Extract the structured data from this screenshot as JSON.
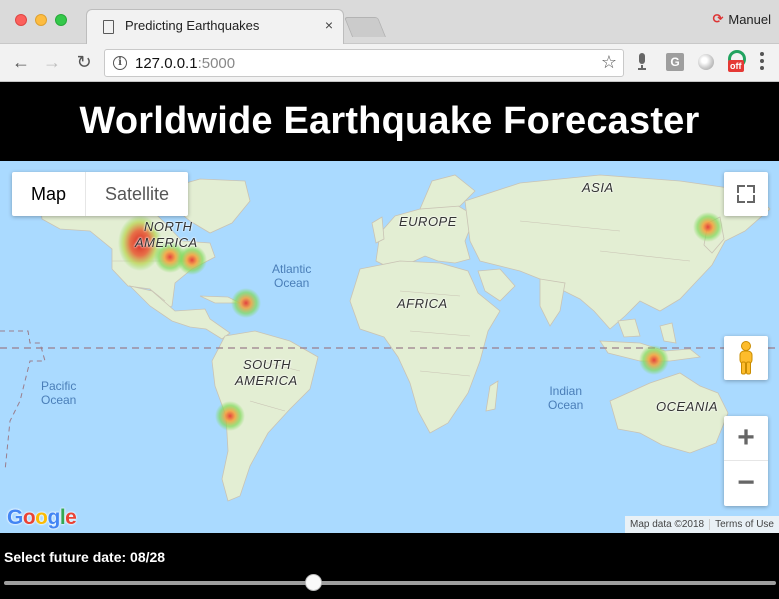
{
  "browser": {
    "tab_title": "Predicting Earthquakes",
    "tab_close": "×",
    "url_host": "127.0.0.1",
    "url_port": ":5000",
    "profile_name": "Manuel",
    "ext_g_label": "G",
    "ext_off_label": "off"
  },
  "page": {
    "title": "Worldwide Earthquake Forecaster"
  },
  "map": {
    "type_buttons": {
      "map": "Map",
      "satellite": "Satellite"
    },
    "labels": {
      "north_america_1": "NORTH",
      "north_america_2": "AMERICA",
      "south_america_1": "SOUTH",
      "south_america_2": "AMERICA",
      "europe": "EUROPE",
      "asia": "ASIA",
      "africa": "AFRICA",
      "oceania": "OCEANIA"
    },
    "oceans": {
      "atlantic_1": "Atlantic",
      "atlantic_2": "Ocean",
      "pacific_1": "Pacific",
      "pacific_2": "Ocean",
      "indian_1": "Indian",
      "indian_2": "Ocean"
    },
    "zoom_in": "+",
    "zoom_out": "−",
    "attribution": "Map data ©2018",
    "terms": "Terms of Use",
    "colors": {
      "water": "#aadaff",
      "land": "#e3eed3",
      "heat_low": "#7ed957",
      "heat_high": "#e53935"
    }
  },
  "controls": {
    "date_label": "Select future date: 08/28",
    "slider_fraction": 0.4
  }
}
